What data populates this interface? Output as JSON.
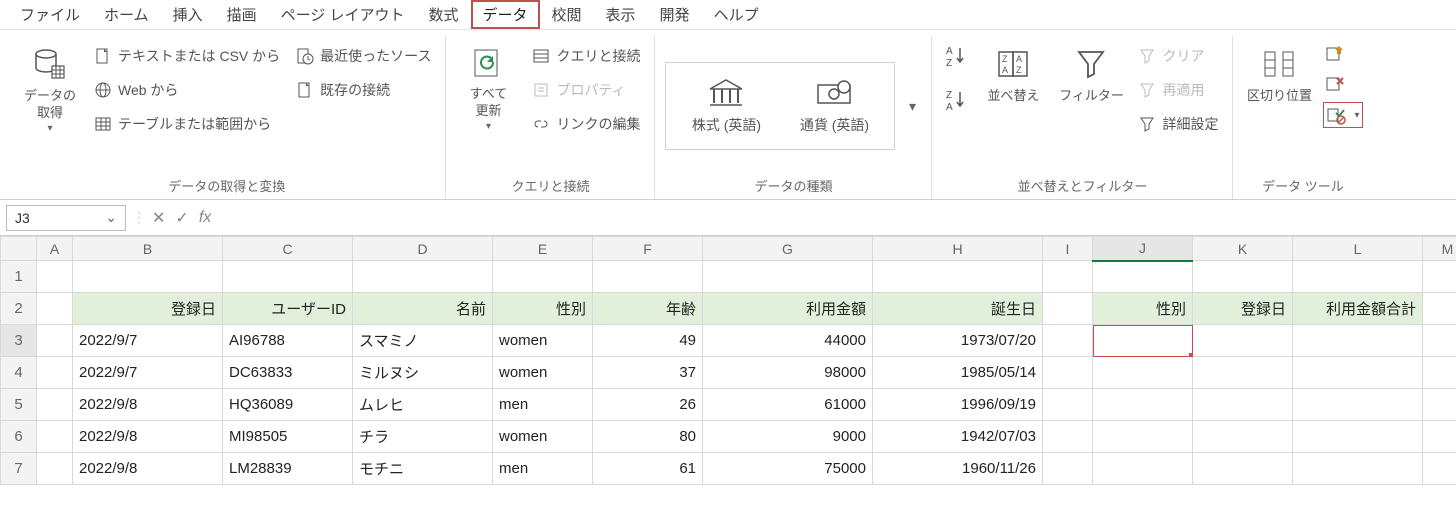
{
  "menubar": {
    "items": [
      "ファイル",
      "ホーム",
      "挿入",
      "描画",
      "ページ レイアウト",
      "数式",
      "データ",
      "校閲",
      "表示",
      "開発",
      "ヘルプ"
    ],
    "active_index": 6
  },
  "ribbon": {
    "groups": {
      "get_transform": {
        "label": "データの取得と変換",
        "get_data": "データの\n取得",
        "from_csv": "テキストまたは CSV から",
        "from_web": "Web から",
        "from_table": "テーブルまたは範囲から",
        "recent": "最近使ったソース",
        "existing": "既存の接続"
      },
      "queries": {
        "label": "クエリと接続",
        "refresh_all": "すべて\n更新",
        "queries_connections": "クエリと接続",
        "properties": "プロパティ",
        "edit_links": "リンクの編集"
      },
      "data_types": {
        "label": "データの種類",
        "stocks": "株式 (英語)",
        "currency": "通貨 (英語)"
      },
      "sort_filter": {
        "label": "並べ替えとフィルター",
        "sort": "並べ替え",
        "filter": "フィルター",
        "clear": "クリア",
        "reapply": "再適用",
        "advanced": "詳細設定"
      },
      "data_tools": {
        "label": "データ ツール",
        "text_to_columns": "区切り位置"
      }
    }
  },
  "name_box": {
    "value": "J3"
  },
  "formula_bar": {
    "value": ""
  },
  "columns": [
    "A",
    "B",
    "C",
    "D",
    "E",
    "F",
    "G",
    "H",
    "I",
    "J",
    "K",
    "L",
    "M"
  ],
  "headers": {
    "B": "登録日",
    "C": "ユーザーID",
    "D": "名前",
    "E": "性別",
    "F": "年齢",
    "G": "利用金額",
    "H": "誕生日",
    "J": "性別",
    "K": "登録日",
    "L": "利用金額合計"
  },
  "rows": [
    {
      "n": 3,
      "B": "2022/9/7",
      "C": "AI96788",
      "D": "スマミノ",
      "E": "women",
      "F": "49",
      "G": "44000",
      "H": "1973/07/20"
    },
    {
      "n": 4,
      "B": "2022/9/7",
      "C": "DC63833",
      "D": "ミルヌシ",
      "E": "women",
      "F": "37",
      "G": "98000",
      "H": "1985/05/14"
    },
    {
      "n": 5,
      "B": "2022/9/8",
      "C": "HQ36089",
      "D": "ムレヒ",
      "E": "men",
      "F": "26",
      "G": "61000",
      "H": "1996/09/19"
    },
    {
      "n": 6,
      "B": "2022/9/8",
      "C": "MI98505",
      "D": "チラ",
      "E": "women",
      "F": "80",
      "G": "9000",
      "H": "1942/07/03"
    },
    {
      "n": 7,
      "B": "2022/9/8",
      "C": "LM28839",
      "D": "モチニ",
      "E": "men",
      "F": "61",
      "G": "75000",
      "H": "1960/11/26"
    }
  ],
  "selected_cell": "J3"
}
